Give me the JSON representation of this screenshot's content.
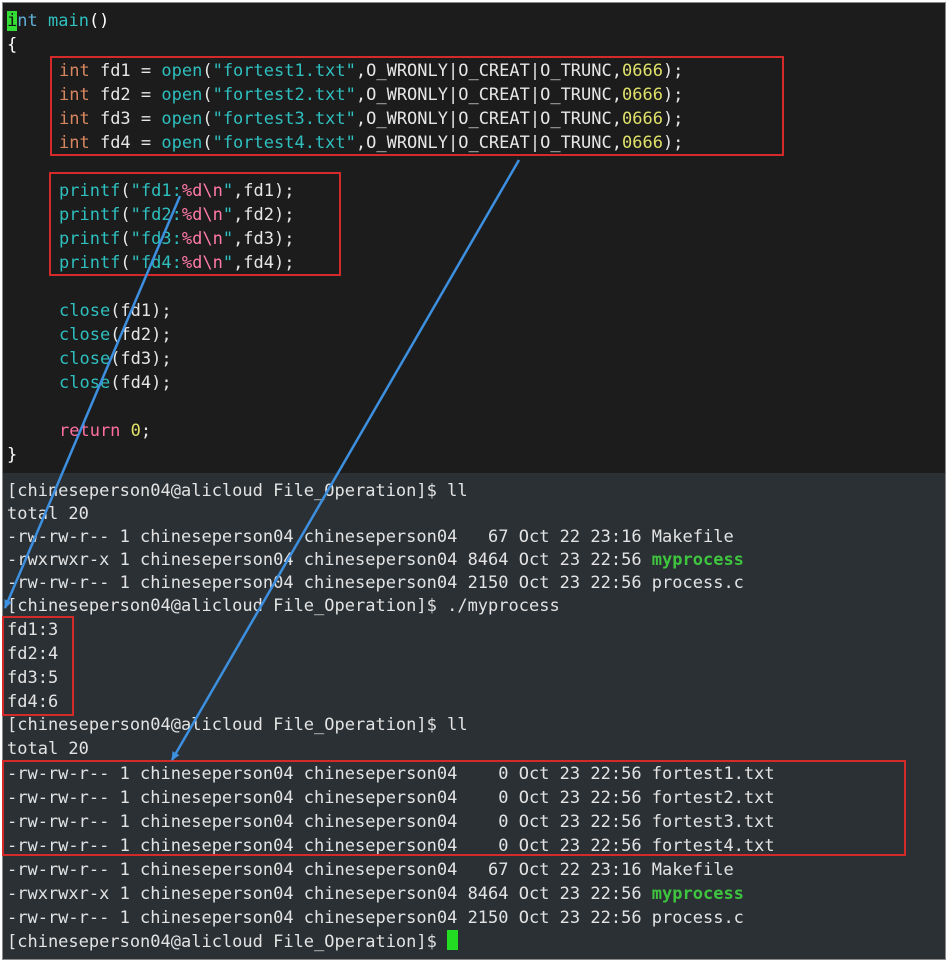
{
  "editor": {
    "sig_type": "int",
    "sig_func": "main",
    "sig_parens": "()",
    "open_brace": "{",
    "open_lines": [
      {
        "type": "int",
        "decl": " fd1 = ",
        "func": "open",
        "arg": "\"fortest1.txt\"",
        "flags": ",O_WRONLY|O_CREAT|O_TRUNC,",
        "mode": "0666",
        "end": ");"
      },
      {
        "type": "int",
        "decl": " fd2 = ",
        "func": "open",
        "arg": "\"fortest2.txt\"",
        "flags": ",O_WRONLY|O_CREAT|O_TRUNC,",
        "mode": "0666",
        "end": ");"
      },
      {
        "type": "int",
        "decl": " fd3 = ",
        "func": "open",
        "arg": "\"fortest3.txt\"",
        "flags": ",O_WRONLY|O_CREAT|O_TRUNC,",
        "mode": "0666",
        "end": ");"
      },
      {
        "type": "int",
        "decl": " fd4 = ",
        "func": "open",
        "arg": "\"fortest4.txt\"",
        "flags": ",O_WRONLY|O_CREAT|O_TRUNC,",
        "mode": "0666",
        "end": ");"
      }
    ],
    "printf_lines": [
      {
        "func": "printf",
        "open": "(",
        "q1": "\"fd1:",
        "fmt": "%d\\n",
        "q2": "\"",
        "rest": ",fd1);"
      },
      {
        "func": "printf",
        "open": "(",
        "q1": "\"fd2:",
        "fmt": "%d\\n",
        "q2": "\"",
        "rest": ",fd2);"
      },
      {
        "func": "printf",
        "open": "(",
        "q1": "\"fd3:",
        "fmt": "%d\\n",
        "q2": "\"",
        "rest": ",fd3);"
      },
      {
        "func": "printf",
        "open": "(",
        "q1": "\"fd4:",
        "fmt": "%d\\n",
        "q2": "\"",
        "rest": ",fd4);"
      }
    ],
    "close_lines": [
      {
        "func": "close",
        "rest": "(fd1);"
      },
      {
        "func": "close",
        "rest": "(fd2);"
      },
      {
        "func": "close",
        "rest": "(fd3);"
      },
      {
        "func": "close",
        "rest": "(fd4);"
      }
    ],
    "return_kw": "return",
    "return_val": "0",
    "return_end": ";",
    "close_brace": "}"
  },
  "terminal": {
    "prompt1": "[chineseperson04@alicloud File_Operation]$ ll",
    "total1": "total 20",
    "listing1": [
      {
        "text": "-rw-rw-r-- 1 chineseperson04 chineseperson04   67 Oct 22 23:16 ",
        "name": "Makefile",
        "exec": false
      },
      {
        "text": "-rwxrwxr-x 1 chineseperson04 chineseperson04 8464 Oct 23 22:56 ",
        "name": "myprocess",
        "exec": true
      },
      {
        "text": "-rw-rw-r-- 1 chineseperson04 chineseperson04 2150 Oct 23 22:56 ",
        "name": "process.c",
        "exec": false
      }
    ],
    "prompt2": "[chineseperson04@alicloud File_Operation]$ ./myprocess",
    "output": [
      "fd1:3",
      "fd2:4",
      "fd3:5",
      "fd4:6"
    ],
    "prompt3": "[chineseperson04@alicloud File_Operation]$ ll",
    "total2": "total 20",
    "listing2": [
      {
        "text": "-rw-rw-r-- 1 chineseperson04 chineseperson04    0 Oct 23 22:56 ",
        "name": "fortest1.txt",
        "exec": false
      },
      {
        "text": "-rw-rw-r-- 1 chineseperson04 chineseperson04    0 Oct 23 22:56 ",
        "name": "fortest2.txt",
        "exec": false
      },
      {
        "text": "-rw-rw-r-- 1 chineseperson04 chineseperson04    0 Oct 23 22:56 ",
        "name": "fortest3.txt",
        "exec": false
      },
      {
        "text": "-rw-rw-r-- 1 chineseperson04 chineseperson04    0 Oct 23 22:56 ",
        "name": "fortest4.txt",
        "exec": false
      },
      {
        "text": "-rw-rw-r-- 1 chineseperson04 chineseperson04   67 Oct 22 23:16 ",
        "name": "Makefile",
        "exec": false
      },
      {
        "text": "-rwxrwxr-x 1 chineseperson04 chineseperson04 8464 Oct 23 22:56 ",
        "name": "myprocess",
        "exec": true
      },
      {
        "text": "-rw-rw-r-- 1 chineseperson04 chineseperson04 2150 Oct 23 22:56 ",
        "name": "process.c",
        "exec": false
      }
    ],
    "prompt4": "[chineseperson04@alicloud File_Operation]$ "
  },
  "colors": {
    "editor_bg": "#1c1c1c",
    "terminal_bg": "#2b3034",
    "highlight_box": "#d42a2a",
    "arrow": "#3d8fe0",
    "executable": "#3ec43e",
    "cursor": "#22dd22"
  }
}
